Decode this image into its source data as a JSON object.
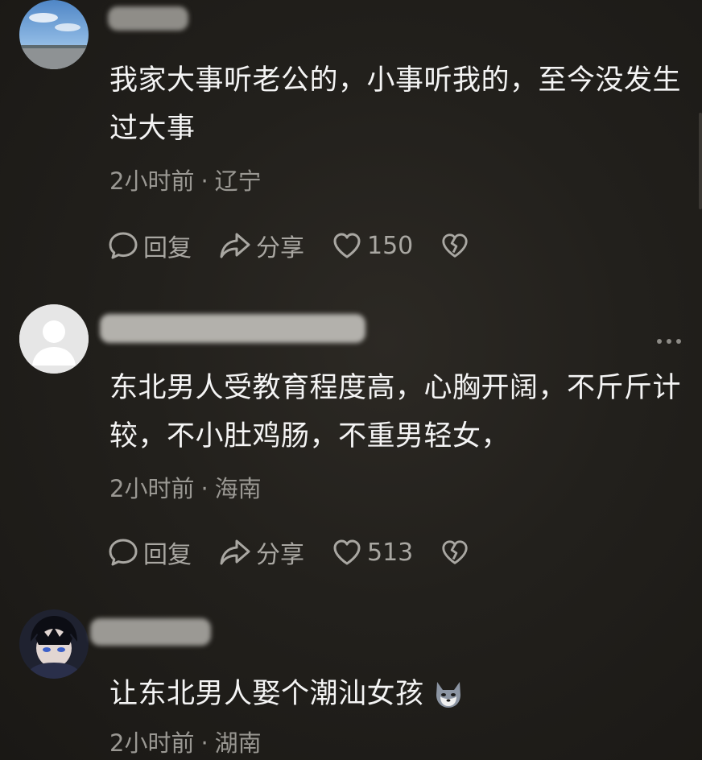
{
  "comments": [
    {
      "text_line1": "我家大事听老公的，小事听我的，至今没发生",
      "text_line2": "过大事",
      "time": "2小时前",
      "location": "辽宁",
      "reply_label": "回复",
      "share_label": "分享",
      "likes": "150"
    },
    {
      "text_line1": "东北男人受教育程度高，心胸开阔，不斤斤计",
      "text_line2": "较，不小肚鸡肠，不重男轻女，",
      "time": "2小时前",
      "location": "海南",
      "reply_label": "回复",
      "share_label": "分享",
      "likes": "513"
    },
    {
      "text_line1": "让东北男人娶个潮汕女孩",
      "time": "2小时前",
      "location": "湖南"
    }
  ],
  "separator": "·",
  "icons": {
    "reply": "speech-bubble-icon",
    "share": "share-arrow-icon",
    "like": "heart-icon",
    "dislike": "broken-heart-icon",
    "more": "more-dots-icon"
  },
  "colors": {
    "background": "#22201c",
    "text": "#f4f4f4",
    "meta": "#9a9893"
  }
}
